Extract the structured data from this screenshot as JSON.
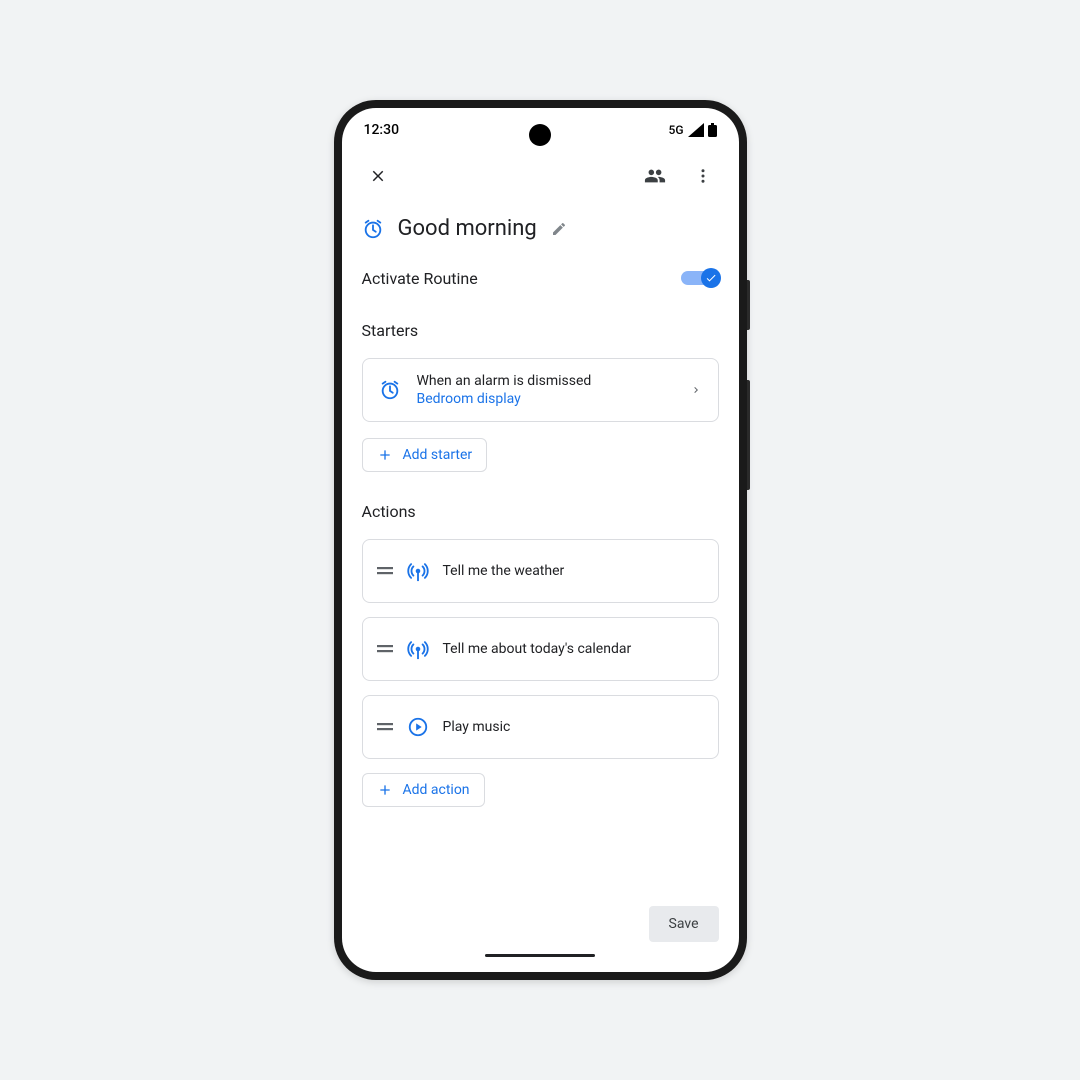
{
  "status_bar": {
    "time": "12:30",
    "network": "5G"
  },
  "title": "Good morning",
  "activate": {
    "label": "Activate Routine",
    "on": true
  },
  "sections": {
    "starters_label": "Starters",
    "actions_label": "Actions"
  },
  "starters": [
    {
      "title": "When an alarm is dismissed",
      "subtitle": "Bedroom display"
    }
  ],
  "add_starter_label": "Add starter",
  "actions": [
    {
      "icon": "broadcast",
      "label": "Tell me the weather"
    },
    {
      "icon": "broadcast",
      "label": "Tell me about today's calendar"
    },
    {
      "icon": "play",
      "label": "Play music"
    }
  ],
  "add_action_label": "Add action",
  "save_label": "Save",
  "colors": {
    "primary": "#1a73e8",
    "outline": "#dadce0"
  }
}
